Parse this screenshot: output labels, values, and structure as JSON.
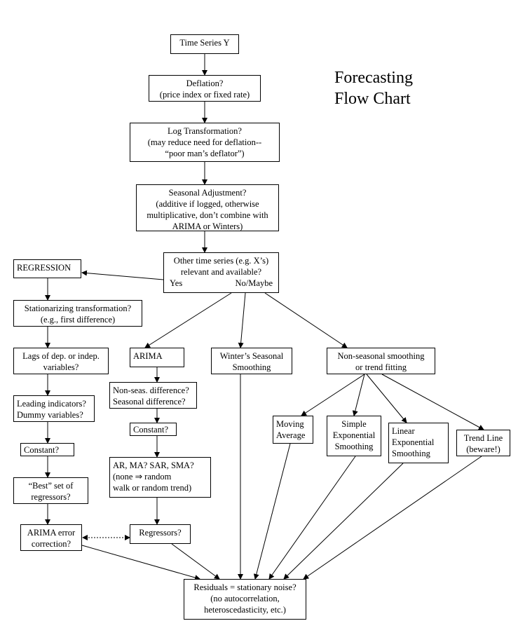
{
  "title": {
    "lines": [
      "Forecasting",
      "Flow Chart"
    ]
  },
  "nodes": {
    "time_series": [
      "Time Series Y"
    ],
    "deflation": [
      "Deflation?",
      "(price index or fixed rate)"
    ],
    "log": [
      "Log Transformation?",
      "(may reduce need for deflation--",
      "“poor man’s deflator”)"
    ],
    "seasonal": [
      "Seasonal Adjustment?",
      "(additive if logged, otherwise",
      "multiplicative, don’t combine with",
      "ARIMA or Winters)"
    ],
    "other": [
      "Other time series (e.g. X’s)",
      "relevant and available?"
    ],
    "other_yes": "Yes",
    "other_no": "No/Maybe",
    "regression": [
      "REGRESSION"
    ],
    "stationarizing": [
      "Stationarizing transformation?",
      "(e.g., first difference)"
    ],
    "lags": [
      "Lags of dep. or indep.",
      "variables?"
    ],
    "leading": [
      "Leading indicators?",
      "Dummy variables?"
    ],
    "constant_left": [
      "Constant?"
    ],
    "best": [
      "“Best” set of",
      "regressors?"
    ],
    "arima_error": [
      "ARIMA error",
      "correction?"
    ],
    "arima": [
      "ARIMA"
    ],
    "nonseas": [
      "Non-seas. difference?",
      "Seasonal difference?"
    ],
    "constant_mid": [
      "Constant?"
    ],
    "armas": [
      "AR, MA?  SAR, SMA?",
      "(none ⇒ random",
      "walk or random trend)"
    ],
    "regressors": [
      "Regressors?"
    ],
    "winters": [
      "Winter’s Seasonal",
      "Smoothing"
    ],
    "nonseasonal_smoothing": [
      "Non-seasonal smoothing",
      "or trend fitting"
    ],
    "moving_average": [
      "Moving",
      "Average"
    ],
    "simple_exp": [
      "Simple",
      "Exponential",
      "Smoothing"
    ],
    "linear_exp": [
      "Linear",
      "Exponential",
      "Smoothing"
    ],
    "trend_line": [
      "Trend Line",
      "(beware!)"
    ],
    "residuals": [
      "Residuals = stationary noise?",
      "(no autocorrelation,",
      "heteroscedasticity, etc.)"
    ]
  }
}
